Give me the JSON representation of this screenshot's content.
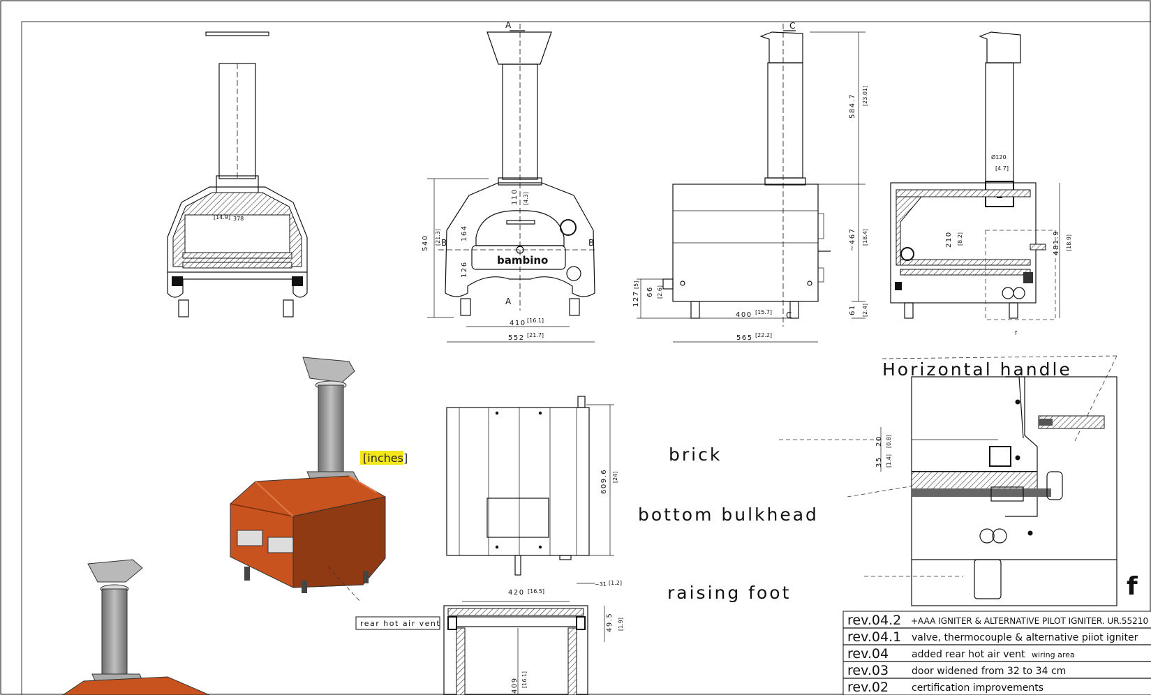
{
  "section_marks": {
    "a_top": "A",
    "a_bottom": "A",
    "b_left": "B",
    "b_right": "B",
    "c_top": "C",
    "c_bottom": "C"
  },
  "front_section": {
    "dim_width": "[14.9]",
    "dim_width_mm": "378"
  },
  "front_view": {
    "logo": "bambino",
    "dim_height": "540",
    "dim_height_in": "[21.3]",
    "dim_110": "110",
    "dim_110_in": "[4.3]",
    "dim_164": "164",
    "dim_126": "126",
    "dim_410": "410",
    "dim_410_in": "[16.1]",
    "dim_552": "552",
    "dim_552_in": "[21.7]"
  },
  "side_view": {
    "dim_584": "584.7",
    "dim_584_in": "[23.01]",
    "dim_467": "~467",
    "dim_467_in": "[18.4]",
    "dim_61": "61",
    "dim_61_in": "[2.4]",
    "dim_127": "127",
    "dim_127_in": "[5]",
    "dim_66": "66",
    "dim_66_in": "[2.6]",
    "dim_400": "400",
    "dim_400_in": "[15.7]",
    "dim_565": "565",
    "dim_565_in": "[22.2]"
  },
  "side_section": {
    "dim_dia": "Ø120",
    "dim_dia_in": "[4.7]",
    "dim_210": "210",
    "dim_210_in": "[8.2]",
    "dim_481": "481.9",
    "dim_481_in": "[18.9]",
    "detail_letter": "f"
  },
  "top_view": {
    "dim_609": "609.6",
    "dim_609_in": "[24]"
  },
  "bottom_section": {
    "dim_420": "420",
    "dim_420_in": "[16.5]",
    "dim_31": "~31",
    "dim_31_in": "[1.2]",
    "dim_49": "49.5",
    "dim_49_in": "[1.9]",
    "dim_409": "409",
    "dim_409_in": "[16.1]"
  },
  "iso": {
    "units_note": "[inches]",
    "rear_vent_label": "rear hot air vent"
  },
  "labels": {
    "horizontal_handle": "Horizontal handle",
    "brick": "brick",
    "bottom_bulkhead": "bottom bulkhead",
    "raising_foot": "raising foot"
  },
  "detail": {
    "dim_20": "20",
    "dim_20_in": "[0.8]",
    "dim_35": "35",
    "dim_35_in": "[1.4]",
    "detail_letter": "f"
  },
  "revisions": [
    {
      "code": "rev.04.2",
      "desc": "+AAA IGNITER & ALTERNATIVE PILOT IGNITER. UR.55210"
    },
    {
      "code": "rev.04.1",
      "desc": "valve, thermocouple & alternative piiot igniter"
    },
    {
      "code": "rev.04",
      "desc": "added rear hot air vent",
      "note": "wiring area"
    },
    {
      "code": "rev.03",
      "desc": "door widened from 32 to 34 cm"
    },
    {
      "code": "rev.02",
      "desc": "certification improvements"
    }
  ],
  "colors": {
    "oven_body": "#c8531f",
    "oven_dark": "#7a2e0c",
    "flue": "#9a9a9a",
    "highlight": "#f5e61a"
  }
}
